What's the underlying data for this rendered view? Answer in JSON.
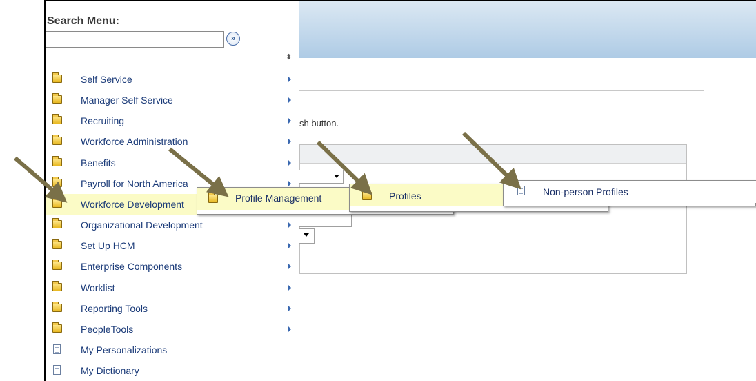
{
  "search_menu": {
    "title": "Search Menu:",
    "input_value": "",
    "go_glyph": "»",
    "sort_glyph": "⬍"
  },
  "background": {
    "instruction_fragment": "sh button."
  },
  "menu_items": [
    {
      "label": "Self Service",
      "icon": "folder-icon",
      "has_arrow": true
    },
    {
      "label": "Manager Self Service",
      "icon": "folder-icon",
      "has_arrow": true
    },
    {
      "label": "Recruiting",
      "icon": "folder-icon",
      "has_arrow": true
    },
    {
      "label": "Workforce Administration",
      "icon": "folder-icon",
      "has_arrow": true
    },
    {
      "label": "Benefits",
      "icon": "folder-icon",
      "has_arrow": true
    },
    {
      "label": "Payroll for North America",
      "icon": "folder-icon",
      "has_arrow": true
    },
    {
      "label": "Workforce Development",
      "icon": "folder-icon",
      "has_arrow": true,
      "highlighted": true
    },
    {
      "label": "Organizational Development",
      "icon": "folder-icon",
      "has_arrow": true
    },
    {
      "label": "Set Up HCM",
      "icon": "folder-icon",
      "has_arrow": true
    },
    {
      "label": "Enterprise Components",
      "icon": "folder-icon",
      "has_arrow": true
    },
    {
      "label": "Worklist",
      "icon": "folder-icon",
      "has_arrow": true
    },
    {
      "label": "Reporting Tools",
      "icon": "folder-icon",
      "has_arrow": true
    },
    {
      "label": "PeopleTools",
      "icon": "folder-icon",
      "has_arrow": true
    },
    {
      "label": "My Personalizations",
      "icon": "document-icon",
      "has_arrow": false
    },
    {
      "label": "My Dictionary",
      "icon": "document-icon",
      "has_arrow": false
    }
  ],
  "flyouts": {
    "level1": {
      "label": "Profile Management",
      "icon": "folder-icon"
    },
    "level2": {
      "label": "Profiles",
      "icon": "folder-icon"
    },
    "level3": {
      "label": "Non-person Profiles",
      "icon": "document-icon"
    }
  },
  "colors": {
    "highlight": "#fbfbc6",
    "link": "#1a3a78",
    "annotation_arrow": "#7a7048"
  }
}
